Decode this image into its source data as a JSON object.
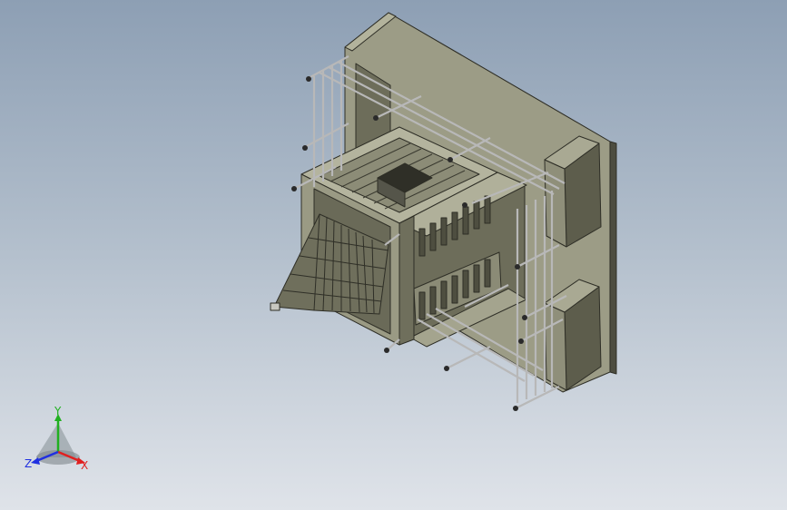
{
  "viewport": {
    "background_top": "#8d9fb4",
    "background_bottom": "#dfe3e9",
    "model_colors": {
      "light": "#9d9d88",
      "mid": "#85856f",
      "dark": "#5a5a4a",
      "edge": "#2e2e26",
      "rod": "#b8b8b8"
    }
  },
  "triad": {
    "x_label": "X",
    "y_label": "Y",
    "z_label": "Z",
    "x_color": "#e02020",
    "y_color": "#20b020",
    "z_color": "#2030e0"
  }
}
